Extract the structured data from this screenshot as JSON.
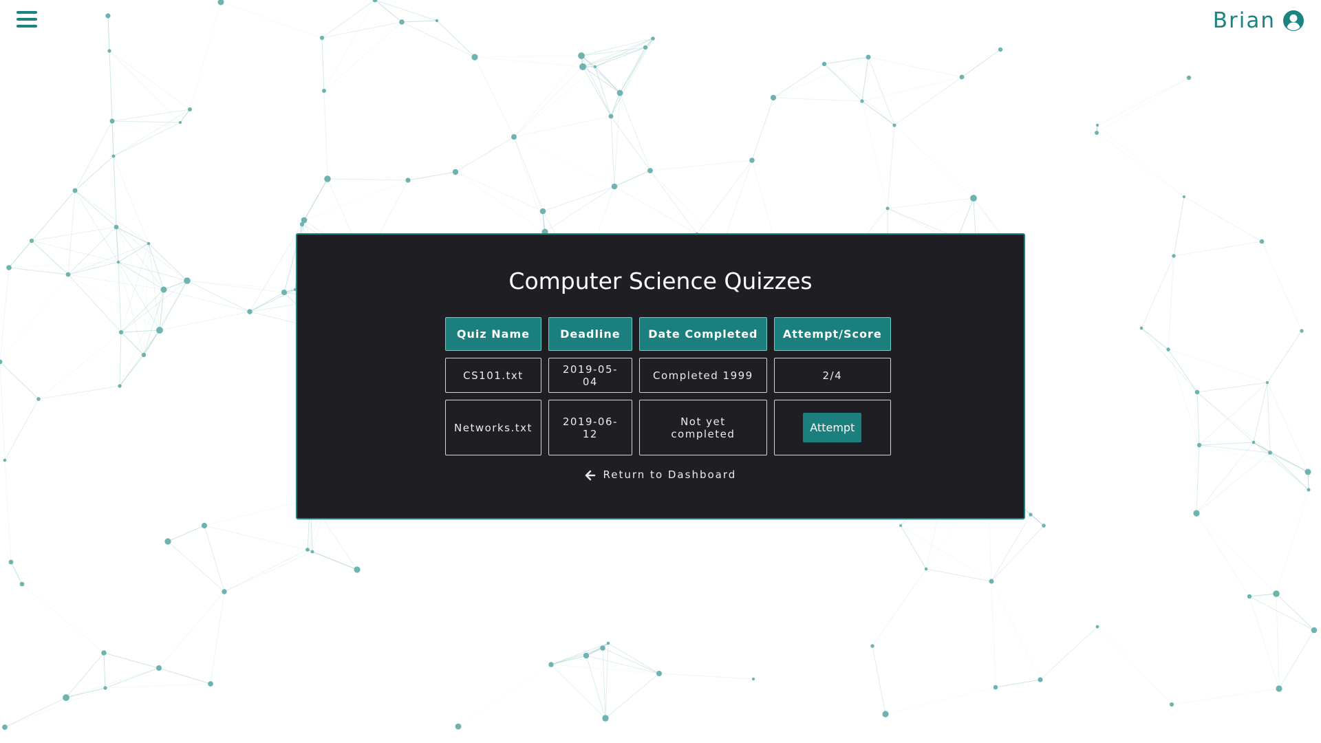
{
  "user": {
    "name": "Brian",
    "avatar_icon": "user-circle-icon"
  },
  "menu": {
    "icon": "hamburger-menu-icon"
  },
  "panel": {
    "title": "Computer Science Quizzes",
    "columns": [
      "Quiz Name",
      "Deadline",
      "Date Completed",
      "Attempt/Score"
    ],
    "rows": [
      {
        "quiz_name": "CS101.txt",
        "deadline": "2019-05-04",
        "date_completed": "Completed 1999",
        "attempt_score": "2/4"
      },
      {
        "quiz_name": "Networks.txt",
        "deadline": "2019-06-12",
        "date_completed": "Not yet completed",
        "attempt_label": "Attempt"
      }
    ],
    "return_label": "Return to Dashboard",
    "return_icon": "arrow-left-icon"
  },
  "colors": {
    "accent": "#1b807d",
    "panel_bg": "#1f1f23",
    "network_node": "#6fb3b0",
    "network_line": "#a9d4d2"
  }
}
